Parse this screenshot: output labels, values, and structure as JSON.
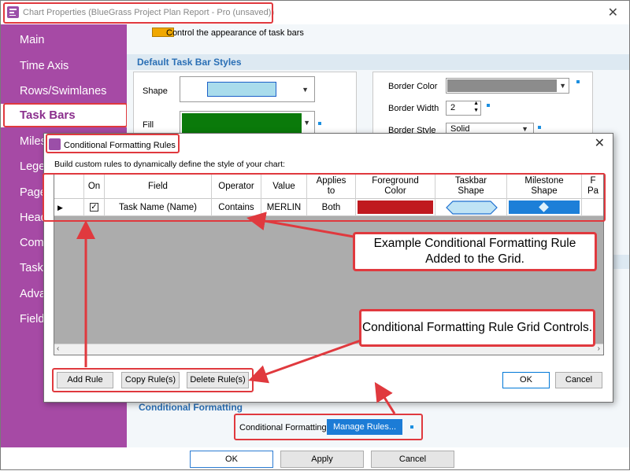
{
  "window": {
    "title": "Chart Properties (BlueGrass Project Plan Report - Pro (unsaved))",
    "close_glyph": "✕"
  },
  "sidebar": {
    "items": [
      {
        "label": "Main"
      },
      {
        "label": "Time Axis"
      },
      {
        "label": "Rows/Swimlanes"
      },
      {
        "label": "Task Bars"
      },
      {
        "label": "Miles"
      },
      {
        "label": "Lege"
      },
      {
        "label": "Page"
      },
      {
        "label": "Head"
      },
      {
        "label": "Com"
      },
      {
        "label": "Task"
      },
      {
        "label": "Adva"
      },
      {
        "label": "Field"
      }
    ],
    "active_index": 3
  },
  "content": {
    "header_text": "Control the appearance of task bars",
    "section_title": "Default Task Bar Styles",
    "shape_label": "Shape",
    "fill_label": "Fill",
    "border_color_label": "Border Color",
    "border_width_label": "Border Width",
    "border_width_value": "2",
    "border_style_label": "Border Style",
    "border_style_value": "Solid",
    "cf_section_title": "Conditional Formatting",
    "cf_label": "Conditional Formatting",
    "manage_rules_label": "Manage Rules..."
  },
  "footer": {
    "ok": "OK",
    "apply": "Apply",
    "cancel": "Cancel"
  },
  "modal": {
    "title": "Conditional Formatting Rules",
    "description": "Build custom rules to dynamically define the style of your chart:",
    "close_glyph": "✕",
    "columns": [
      "On",
      "Field",
      "Operator",
      "Value",
      "Applies to",
      "Foreground Color",
      "Taskbar Shape",
      "Milestone Shape",
      "F Pa"
    ],
    "row": {
      "on": true,
      "field": "Task Name (Name)",
      "operator": "Contains",
      "value": "MERLIN",
      "applies_to": "Both",
      "foreground_color": "#c0191f",
      "taskbar_shape_color": "#bfe3f5",
      "milestone_shape_color": "#1d7fd8"
    },
    "buttons": {
      "add_rule": "Add Rule",
      "copy_rules": "Copy Rule(s)",
      "delete_rules": "Delete Rule(s)",
      "ok": "OK",
      "cancel": "Cancel"
    }
  },
  "callouts": {
    "grid_rule": "Example Conditional Formatting Rule Added to the Grid.",
    "grid_controls": "Conditional Formatting Rule Grid Controls."
  },
  "colors": {
    "sidebar_bg": "#a64aa5",
    "accent_red": "#e0393e",
    "fill_green": "#0a7a0a",
    "border_gray": "#8c8c8c",
    "shape_blue": "#a9dcec",
    "section_blue": "#2a6fb5"
  },
  "icons": [
    "app-icon",
    "close-icon",
    "chevron-down-icon",
    "spin-up-icon",
    "spin-down-icon",
    "checkbox-icon",
    "row-selector-icon"
  ]
}
